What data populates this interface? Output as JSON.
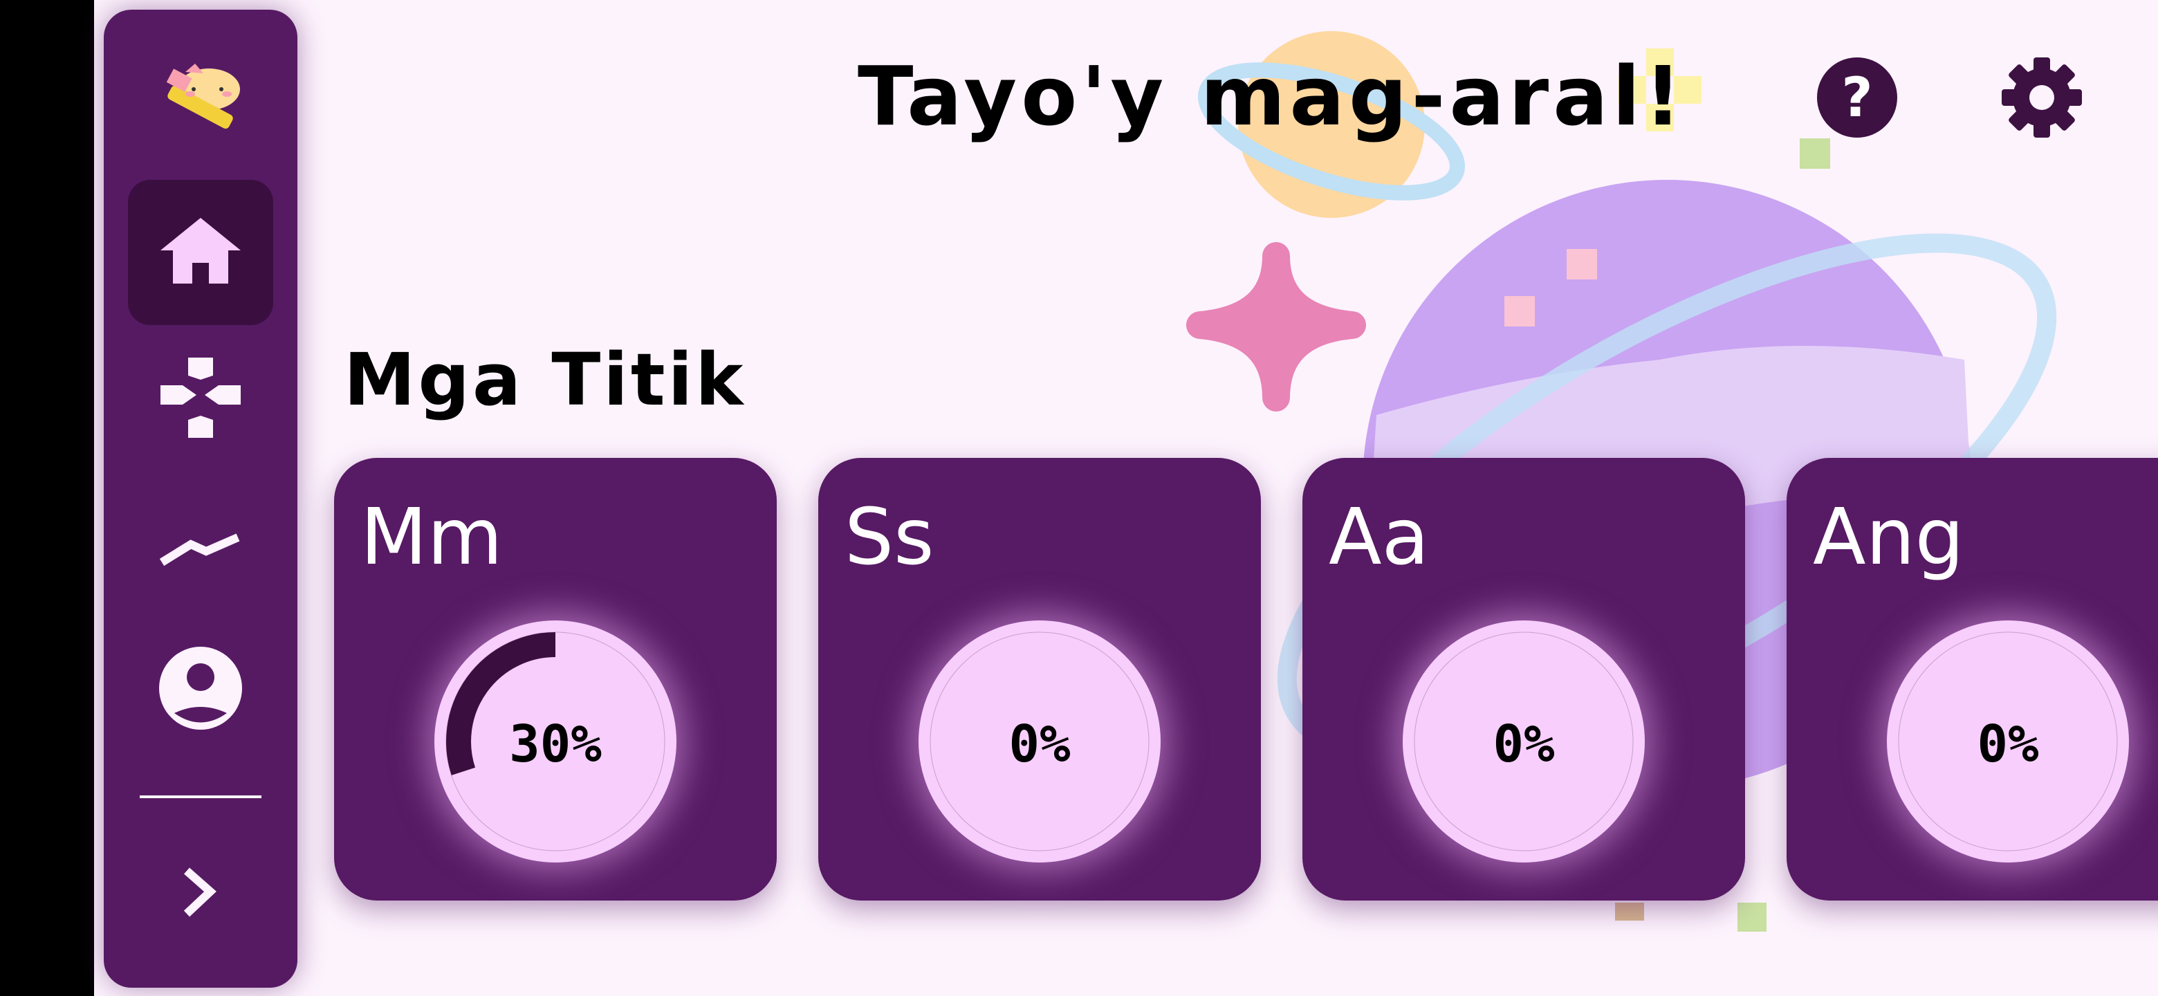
{
  "header": {
    "title": "Tayo'y mag-aral!",
    "help_icon": "help-icon",
    "settings_icon": "gear-icon"
  },
  "sidebar": {
    "logo": "cat-with-pencil-logo",
    "items": [
      {
        "name": "home",
        "icon": "home-icon",
        "active": true
      },
      {
        "name": "games",
        "icon": "gamepad-icon",
        "active": false
      },
      {
        "name": "progress",
        "icon": "chart-icon",
        "active": false
      },
      {
        "name": "profile",
        "icon": "profile-icon",
        "active": false
      }
    ],
    "expand_icon": "chevron-right-icon"
  },
  "section_title": "Mga Titik",
  "cards": [
    {
      "letter": "Mm",
      "progress": 30,
      "progress_label": "30%"
    },
    {
      "letter": "Ss",
      "progress": 0,
      "progress_label": "0%"
    },
    {
      "letter": "Aa",
      "progress": 0,
      "progress_label": "0%"
    },
    {
      "letter": "Ang",
      "progress": 0,
      "progress_label": "0%"
    }
  ],
  "colors": {
    "sidebar": "#561a63",
    "active": "#3a0f40",
    "card": "#571a64",
    "ring": "#f7cefc",
    "background": "#fdf3fd"
  }
}
